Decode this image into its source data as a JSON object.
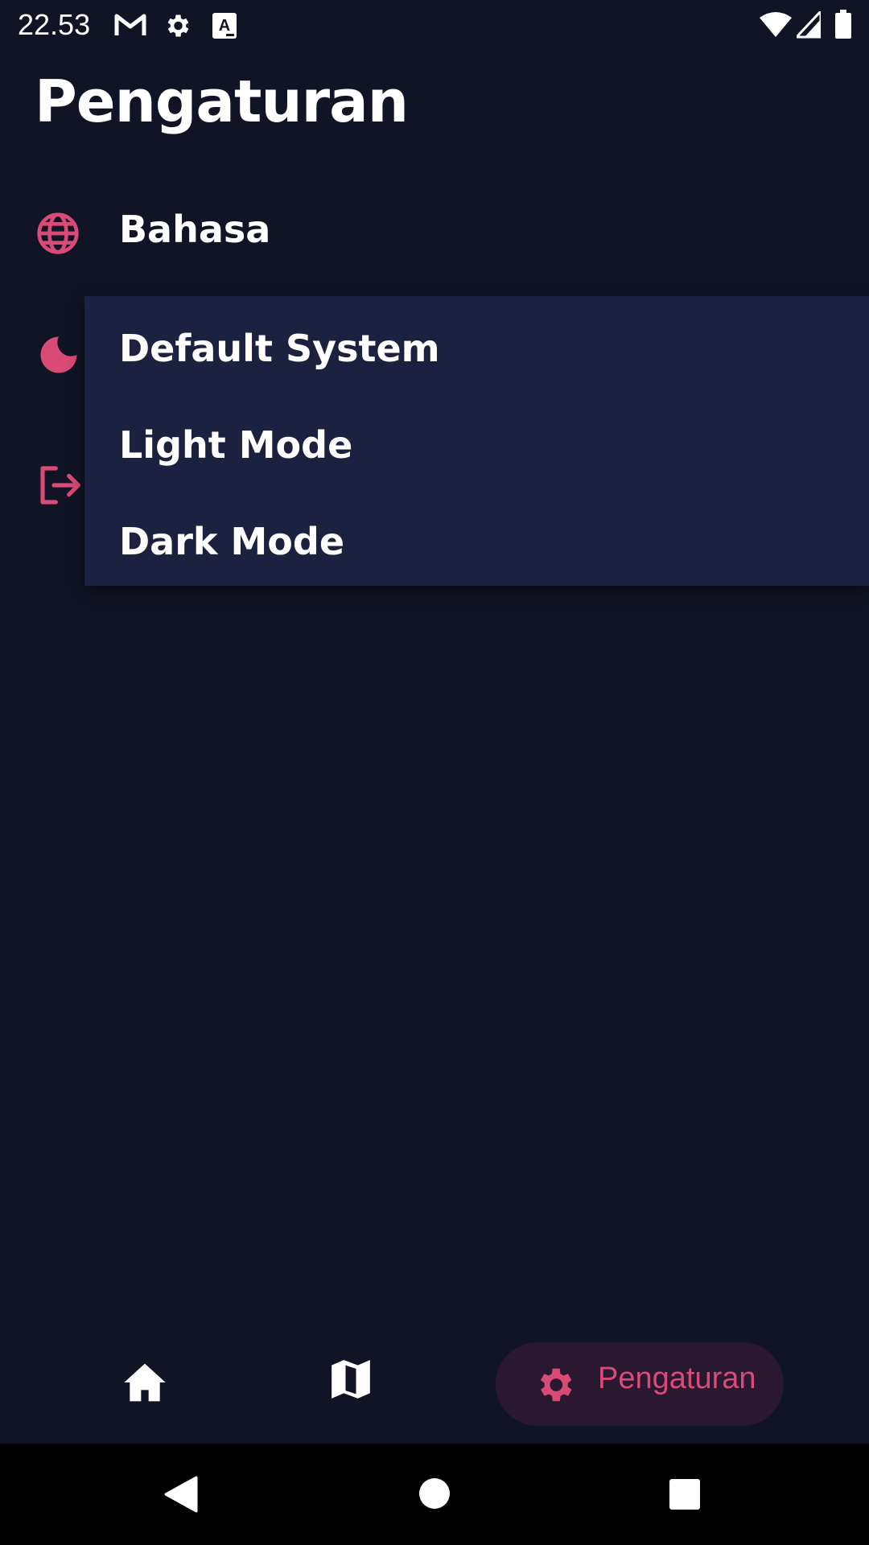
{
  "status_bar": {
    "time": "22.53",
    "icons": [
      "gmail-icon",
      "settings-gear-icon",
      "translate-icon",
      "wifi-icon",
      "signal-icon",
      "battery-icon"
    ]
  },
  "page": {
    "title": "Pengaturan"
  },
  "settings": {
    "items": [
      {
        "label": "Bahasa",
        "icon": "globe-icon"
      },
      {
        "label": "",
        "icon": "moon-icon"
      },
      {
        "label": "",
        "icon": "logout-icon"
      }
    ]
  },
  "theme_dropdown": {
    "options": [
      "Default System",
      "Light Mode",
      "Dark Mode"
    ]
  },
  "bottom_nav": {
    "items": [
      {
        "icon": "home-icon",
        "label": ""
      },
      {
        "icon": "map-icon",
        "label": ""
      },
      {
        "icon": "gear-icon",
        "label": "Pengaturan",
        "active": true
      }
    ]
  },
  "system_nav": {
    "buttons": [
      "back-icon",
      "home-circle-icon",
      "recents-icon"
    ]
  },
  "colors": {
    "background": "#111424",
    "dropdown": "#1d2140",
    "accent": "#d94a76",
    "active_pill": "#2a1830"
  }
}
